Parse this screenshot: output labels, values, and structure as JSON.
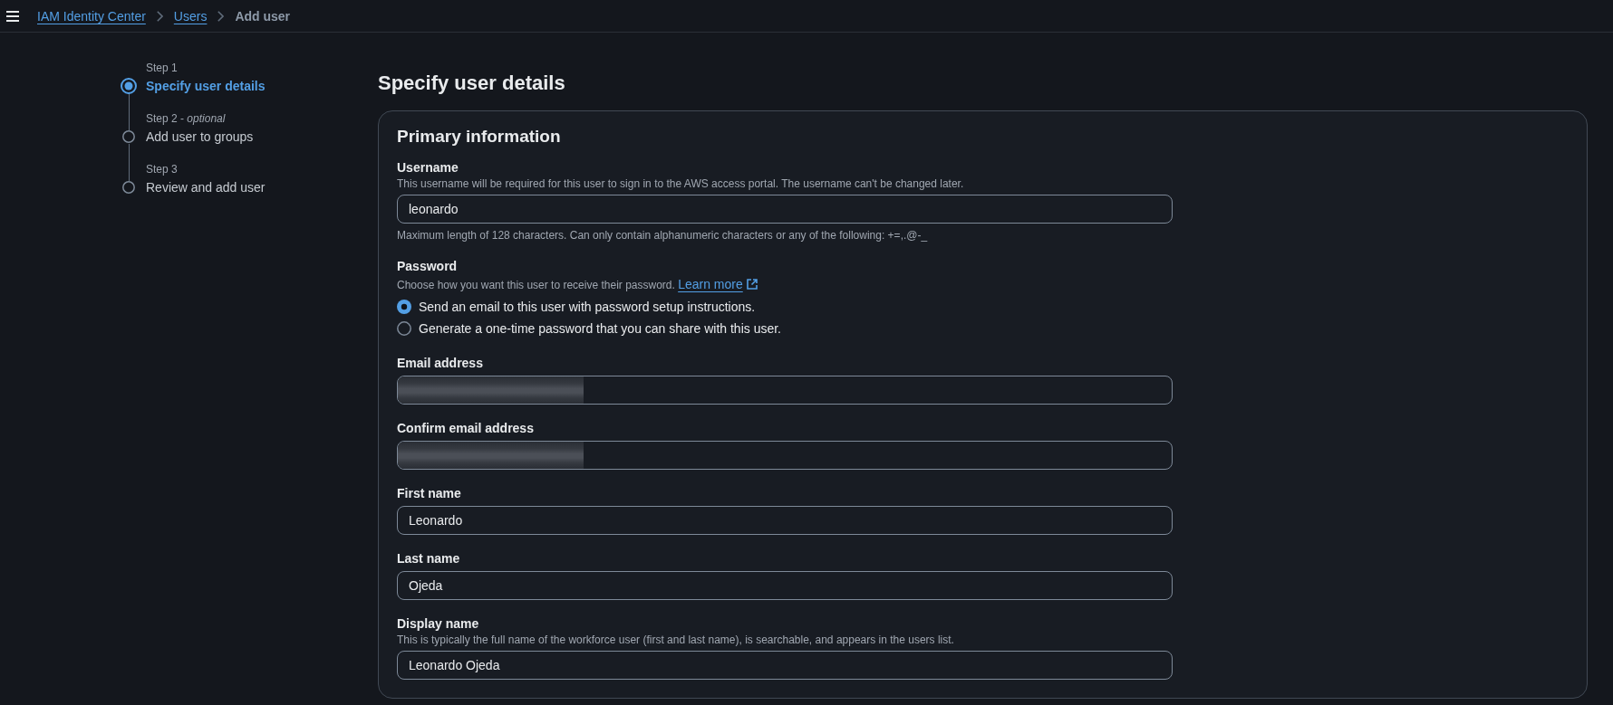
{
  "header": {
    "breadcrumbs": [
      {
        "label": "IAM Identity Center",
        "kind": "link"
      },
      {
        "label": "Users",
        "kind": "link"
      },
      {
        "label": "Add user",
        "kind": "current"
      }
    ]
  },
  "steps": [
    {
      "step": "Step 1",
      "title": "Specify user details",
      "selected": true
    },
    {
      "step": "Step 2 - *optional*",
      "title": "Add user to groups",
      "selected": false
    },
    {
      "step": "Step 3",
      "title": "Review and add user",
      "selected": false
    }
  ],
  "page_title": "Specify user details",
  "panel": {
    "title": "Primary information",
    "fields": [
      {
        "kind": "text",
        "label": "Username",
        "description": "This username will be required for this user to sign in to the AWS access portal. The username can't be changed later.",
        "value": "leonardo",
        "constraint": "Maximum length of 128 characters. Can only contain alphanumeric characters or any of the following: +=,.@-_"
      },
      {
        "kind": "radio",
        "label": "Password",
        "description": "Choose how you want this user to receive their password.",
        "link": "Learn more",
        "options": [
          {
            "label": "Send an email to this user with password setup instructions.",
            "selected": true
          },
          {
            "label": "Generate a one-time password that you can share with this user.",
            "selected": false
          }
        ]
      },
      {
        "kind": "redacted",
        "label": "Email address"
      },
      {
        "kind": "redacted",
        "label": "Confirm email address"
      },
      {
        "kind": "text",
        "label": "First name",
        "value": "Leonardo"
      },
      {
        "kind": "text",
        "label": "Last name",
        "value": "Ojeda"
      },
      {
        "kind": "text",
        "label": "Display name",
        "description": "This is typically the full name of the workforce user (first and last name), is searchable, and appears in the users list.",
        "value": "Leonardo Ojeda"
      }
    ]
  }
}
